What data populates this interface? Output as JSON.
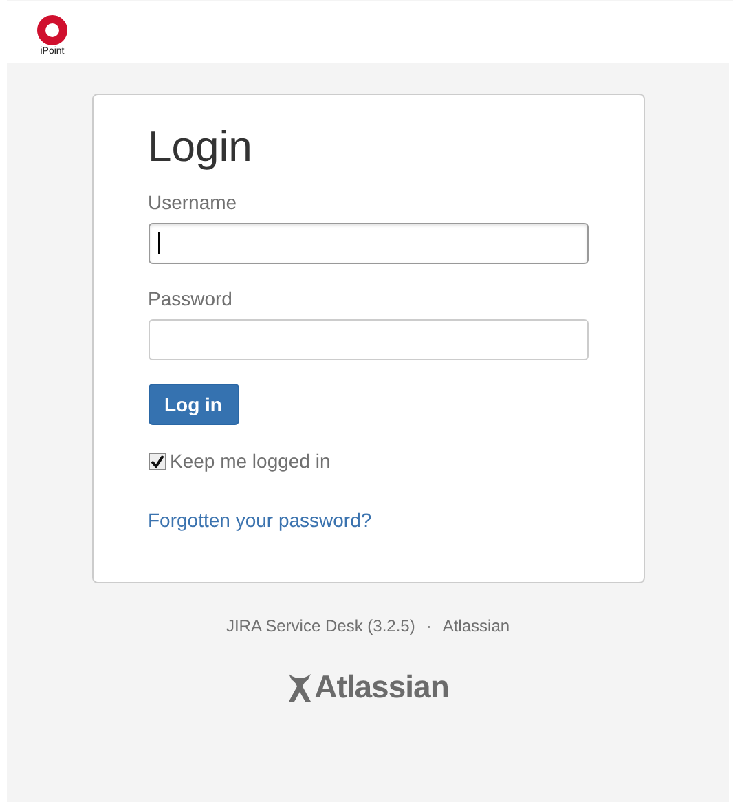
{
  "header": {
    "logo_text": "iPoint"
  },
  "login": {
    "title": "Login",
    "fields": [
      {
        "label": "Username",
        "focused": true
      },
      {
        "label": "Password",
        "focused": false
      }
    ],
    "submit": "Log in",
    "remember": {
      "label": "Keep me logged in",
      "checked": true
    },
    "forgot_link": "Forgotten your password?"
  },
  "footer": {
    "product": "JIRA Service Desk (3.2.5)",
    "separator": "·",
    "vendor": "Atlassian",
    "logo_text": "Atlassian"
  }
}
